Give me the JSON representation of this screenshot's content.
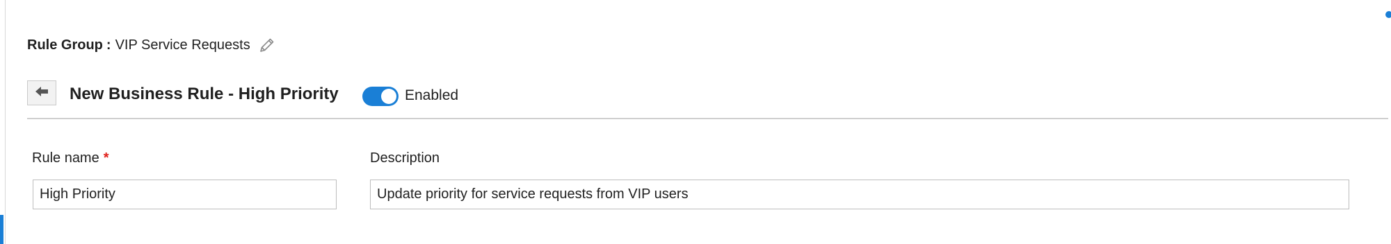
{
  "rule_group": {
    "label": "Rule Group",
    "separator": ":",
    "value": "VIP Service Requests",
    "edit_icon": "pencil-icon"
  },
  "header": {
    "back_icon": "arrow-left-icon",
    "title": "New Business Rule - High Priority",
    "toggle": {
      "state": "on",
      "label": "Enabled"
    }
  },
  "form": {
    "rule_name": {
      "label": "Rule name",
      "required_marker": "*",
      "value": "High Priority"
    },
    "description": {
      "label": "Description",
      "value": "Update priority for service requests from VIP users"
    }
  },
  "colors": {
    "accent": "#1a7fd6",
    "required": "#e0201b",
    "divider": "#cfcfcf"
  }
}
